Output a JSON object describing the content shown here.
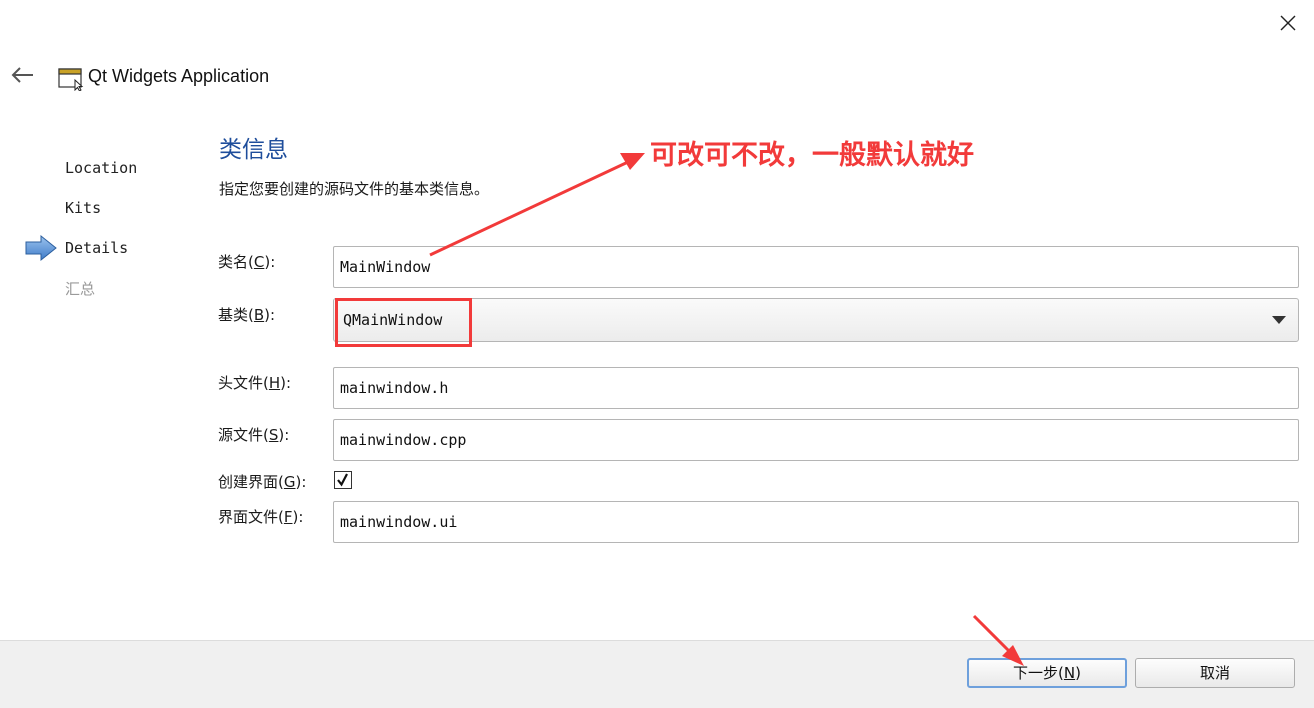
{
  "window": {
    "title": "Qt Widgets Application"
  },
  "steps": [
    {
      "label": "Location"
    },
    {
      "label": "Kits"
    },
    {
      "label": "Details"
    },
    {
      "label": "汇总"
    }
  ],
  "page": {
    "title": "类信息",
    "subtitle": "指定您要创建的源码文件的基本类信息。"
  },
  "fields": {
    "class_name": {
      "label": "类名",
      "accel": "C",
      "value": "MainWindow"
    },
    "base_class": {
      "label": "基类",
      "accel": "B",
      "value": "QMainWindow"
    },
    "header_file": {
      "label": "头文件",
      "accel": "H",
      "value": "mainwindow.h"
    },
    "source_file": {
      "label": "源文件",
      "accel": "S",
      "value": "mainwindow.cpp"
    },
    "create_form": {
      "label": "创建界面",
      "accel": "G",
      "checked": true
    },
    "form_file": {
      "label": "界面文件",
      "accel": "F",
      "value": "mainwindow.ui"
    }
  },
  "annotation": {
    "text": "可改可不改，一般默认就好",
    "color": "#f23a3a"
  },
  "buttons": {
    "next": {
      "label": "下一步",
      "accel": "N"
    },
    "cancel": {
      "label": "取消"
    }
  },
  "icons": {
    "close": "close-icon",
    "back": "back-arrow-icon",
    "app": "qt-window-icon",
    "current_step": "current-step-arrow-icon"
  },
  "colors": {
    "accent_title": "#1e4d9b",
    "annotation_red": "#f23a3a",
    "default_button_border": "#6ea0dc"
  }
}
